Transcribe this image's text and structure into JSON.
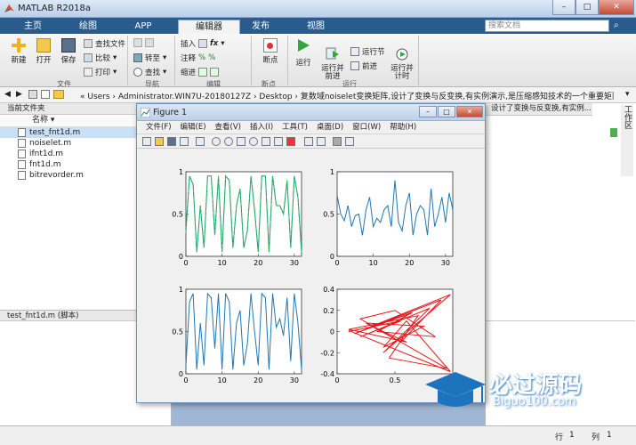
{
  "app": {
    "title": "MATLAB R2018a"
  },
  "tabs": [
    {
      "label": "主页"
    },
    {
      "label": "绘图"
    },
    {
      "label": "APP"
    },
    {
      "label": "编辑器"
    },
    {
      "label": "发布"
    },
    {
      "label": "视图"
    }
  ],
  "search": {
    "placeholder": "搜索文档"
  },
  "ribbon": {
    "new": "新建",
    "open": "打开",
    "save": "保存",
    "find_files": "查找文件",
    "compare": "比较",
    "print": "打印",
    "file_group": "文件",
    "goto": "转至",
    "find": "查找",
    "nav_group": "导航",
    "insert": "插入",
    "comment": "注释",
    "indent": "缩进",
    "edit_group": "编辑",
    "fx": "fx",
    "breakpoints": "断点",
    "bp_group": "断点",
    "run": "运行",
    "run_advance": "运行并\n前进",
    "run_section": "运行节",
    "advance": "前进",
    "run_time": "运行并\n计时",
    "run_group": "运行"
  },
  "address": {
    "path": "« Users › Administrator.WIN7U-20180127Z › Desktop › 复数域noiselet变换矩阵,设计了变换与反变换,有实例演示,是压缩感知技术的一个重要矩阵"
  },
  "left_panel": {
    "title": "当前文件夹",
    "column": "名称",
    "files": [
      {
        "name": "test_fnt1d.m",
        "selected": true
      },
      {
        "name": "noiselet.m",
        "selected": false
      },
      {
        "name": "ifnt1d.m",
        "selected": false
      },
      {
        "name": "fnt1d.m",
        "selected": false
      },
      {
        "name": "bitrevorder.m",
        "selected": false
      }
    ],
    "details": "test_fnt1d.m  (脚本)"
  },
  "right_panel": {
    "title_fragment": "设计了变换与反变换,有实例...",
    "vertical_label": "工作区"
  },
  "status": {
    "row_label": "行",
    "row": "1",
    "col_label": "列",
    "col": "1"
  },
  "figure": {
    "title": "Figure 1",
    "menu": [
      "文件(F)",
      "编辑(E)",
      "查看(V)",
      "插入(I)",
      "工具(T)",
      "桌面(D)",
      "窗口(W)",
      "帮助(H)"
    ]
  },
  "colors": {
    "blue": "#1f77b4",
    "green": "#2ecc40",
    "red": "#e8161b",
    "tab_bar": "#2a5b8c"
  },
  "watermark": {
    "cn": "必过源码",
    "url": "Biguo100.com"
  },
  "chart_data": [
    {
      "type": "line",
      "series": [
        {
          "values": [
            0.3,
            0.95,
            0.85,
            0.05,
            0.6,
            0.1,
            0.95,
            0.95,
            0.25,
            0.95,
            0.05,
            0.95,
            0.9,
            0.1,
            0.6,
            0.8,
            0.1,
            0.3,
            0.95,
            0.55,
            0.05,
            0.95,
            0.95,
            0.05,
            0.95,
            0.6,
            0.6,
            0.5,
            0.9,
            0.1,
            0.95,
            0.7,
            0.05
          ]
        },
        {
          "values": [
            0.28,
            0.95,
            0.85,
            0.05,
            0.6,
            0.1,
            0.95,
            0.95,
            0.25,
            0.95,
            0.05,
            0.95,
            0.9,
            0.1,
            0.6,
            0.8,
            0.1,
            0.3,
            0.95,
            0.55,
            0.05,
            0.95,
            0.95,
            0.05,
            0.95,
            0.6,
            0.6,
            0.5,
            0.9,
            0.1,
            0.95,
            0.7,
            0.05
          ]
        }
      ],
      "x": [
        0,
        1,
        2,
        3,
        4,
        5,
        6,
        7,
        8,
        9,
        10,
        11,
        12,
        13,
        14,
        15,
        16,
        17,
        18,
        19,
        20,
        21,
        22,
        23,
        24,
        25,
        26,
        27,
        28,
        29,
        30,
        31,
        32
      ],
      "xlim": [
        0,
        32
      ],
      "ylim": [
        0,
        1
      ],
      "xticks": [
        0,
        10,
        20,
        30
      ],
      "yticks": [
        0,
        0.5,
        1
      ]
    },
    {
      "type": "line",
      "series": [
        {
          "values": [
            0.72,
            0.5,
            0.42,
            0.6,
            0.35,
            0.48,
            0.5,
            0.25,
            0.55,
            0.7,
            0.35,
            0.45,
            0.4,
            0.55,
            0.6,
            0.35,
            0.9,
            0.4,
            0.3,
            0.6,
            0.75,
            0.25,
            0.5,
            0.6,
            0.55,
            0.25,
            0.8,
            0.35,
            0.5,
            0.7,
            0.4,
            0.75,
            0.55
          ]
        }
      ],
      "x": [
        0,
        1,
        2,
        3,
        4,
        5,
        6,
        7,
        8,
        9,
        10,
        11,
        12,
        13,
        14,
        15,
        16,
        17,
        18,
        19,
        20,
        21,
        22,
        23,
        24,
        25,
        26,
        27,
        28,
        29,
        30,
        31,
        32
      ],
      "xlim": [
        0,
        32
      ],
      "ylim": [
        0,
        1
      ],
      "xticks": [
        0,
        10,
        20,
        30
      ],
      "yticks": [
        0,
        0.5,
        1
      ]
    },
    {
      "type": "line",
      "series": [
        {
          "values": [
            0.1,
            0.85,
            0.95,
            0.05,
            0.6,
            0.1,
            0.95,
            0.9,
            0.3,
            0.95,
            0.05,
            0.95,
            0.85,
            0.05,
            0.6,
            0.75,
            0.1,
            0.35,
            0.95,
            0.5,
            0.1,
            0.95,
            0.9,
            0.05,
            0.95,
            0.55,
            0.65,
            0.45,
            0.9,
            0.15,
            0.95,
            0.6,
            0.05
          ]
        }
      ],
      "x": [
        0,
        1,
        2,
        3,
        4,
        5,
        6,
        7,
        8,
        9,
        10,
        11,
        12,
        13,
        14,
        15,
        16,
        17,
        18,
        19,
        20,
        21,
        22,
        23,
        24,
        25,
        26,
        27,
        28,
        29,
        30,
        31,
        32
      ],
      "xlim": [
        0,
        32
      ],
      "ylim": [
        0,
        1
      ],
      "xticks": [
        0,
        10,
        20,
        30
      ],
      "yticks": [
        0,
        0.5,
        1
      ]
    },
    {
      "type": "line",
      "series": [
        {
          "x": [
            0.1,
            0.55,
            0.2,
            0.8,
            0.4,
            0.98,
            0.3,
            0.6,
            0.1,
            0.7,
            0.45,
            0.95,
            0.2,
            0.5,
            0.85,
            0.35,
            0.65,
            0.15,
            0.9,
            0.55,
            0.25,
            0.75,
            0.4,
            0.6,
            0.98,
            0.1
          ],
          "y": [
            0.0,
            0.1,
            -0.05,
            0.22,
            -0.2,
            0.35,
            0.05,
            -0.1,
            0.02,
            0.15,
            -0.25,
            -0.35,
            0.12,
            0.2,
            -0.05,
            0.0,
            0.18,
            -0.02,
            0.3,
            -0.1,
            0.08,
            0.05,
            -0.15,
            0.1,
            -0.38,
            0.01
          ]
        }
      ],
      "xlim": [
        0,
        1
      ],
      "ylim": [
        -0.4,
        0.4
      ],
      "xticks": [
        0,
        0.5
      ],
      "yticks": [
        -0.4,
        -0.2,
        0,
        0.2,
        0.4
      ]
    }
  ]
}
